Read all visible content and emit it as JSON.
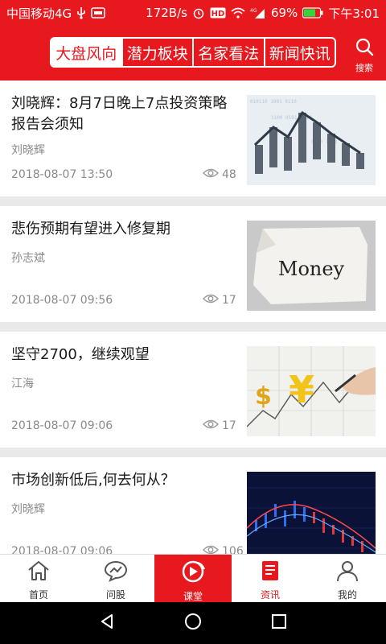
{
  "status_bar": {
    "carrier": "中国移动4G",
    "speed": "172B/s",
    "signal_label": "4G",
    "battery": "69%",
    "time": "下午3:01",
    "hd_label": "HD"
  },
  "header": {
    "tabs": [
      {
        "label": "大盘风向",
        "active": true
      },
      {
        "label": "潜力板块",
        "active": false
      },
      {
        "label": "名家看法",
        "active": false
      },
      {
        "label": "新闻快讯",
        "active": false
      }
    ],
    "search_label": "搜索"
  },
  "articles": [
    {
      "title": "刘晓辉：8月7日晚上7点投资策略报告会须知",
      "author": "刘晓辉",
      "date": "2018-08-07 13:50",
      "views": "48",
      "thumb": "bar-chart-image"
    },
    {
      "title": "悲伤预期有望进入修复期",
      "author": "孙志斌",
      "date": "2018-08-07 09:56",
      "views": "17",
      "thumb": "money-paper-image",
      "thumb_text": "Money"
    },
    {
      "title": "坚守2700，继续观望",
      "author": "江海",
      "date": "2018-08-07 09:06",
      "views": "17",
      "thumb": "currency-drawing-image",
      "thumb_symbols": [
        "$",
        "¥"
      ]
    },
    {
      "title": "市场创新低后,何去何从？",
      "author": "刘晓辉",
      "date": "2018-08-07 09:06",
      "views": "106",
      "thumb": "stock-chart-image"
    }
  ],
  "bottom_nav": [
    {
      "label": "首页",
      "icon": "home-icon"
    },
    {
      "label": "问股",
      "icon": "chat-trend-icon"
    },
    {
      "label": "课堂",
      "icon": "live-play-icon"
    },
    {
      "label": "资讯",
      "icon": "news-doc-icon"
    },
    {
      "label": "我的",
      "icon": "user-icon"
    }
  ],
  "colors": {
    "brand": "#e8191e",
    "text": "#1a1a1a",
    "muted": "#8a8a8a"
  }
}
